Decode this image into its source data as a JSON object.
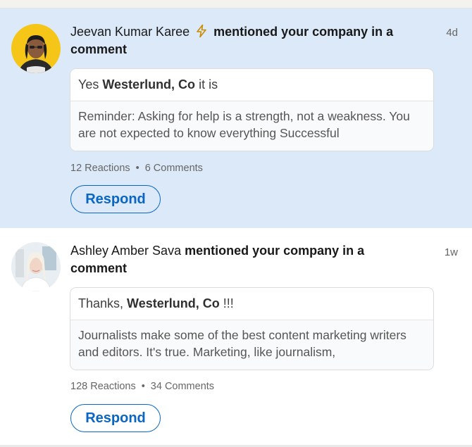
{
  "notifications": [
    {
      "name": "Jeevan Kumar Karee",
      "has_bolt": true,
      "action": "mentioned your company in a comment",
      "time": "4d",
      "reply_prefix": "Yes ",
      "reply_mention": "Westerlund, Co",
      "reply_suffix": " it is",
      "excerpt": "Reminder: Asking for help is a strength, not a weakness. You are not expected to know everything Successful",
      "reactions": "12 Reactions",
      "comments": "6 Comments",
      "respond_label": "Respond",
      "unread": true
    },
    {
      "name": "Ashley Amber Sava",
      "has_bolt": false,
      "action": "mentioned your company in a comment",
      "time": "1w",
      "reply_prefix": "Thanks, ",
      "reply_mention": "Westerlund, Co",
      "reply_suffix": " !!!",
      "excerpt": "Journalists make some of the best content marketing writers and editors. It's true. Marketing, like journalism,",
      "reactions": "128 Reactions",
      "comments": "34 Comments",
      "respond_label": "Respond",
      "unread": false
    }
  ],
  "separator": "•",
  "colors": {
    "unread_bg": "#dce9f8",
    "accent": "#0a66c2",
    "bolt": "#d99a00"
  }
}
